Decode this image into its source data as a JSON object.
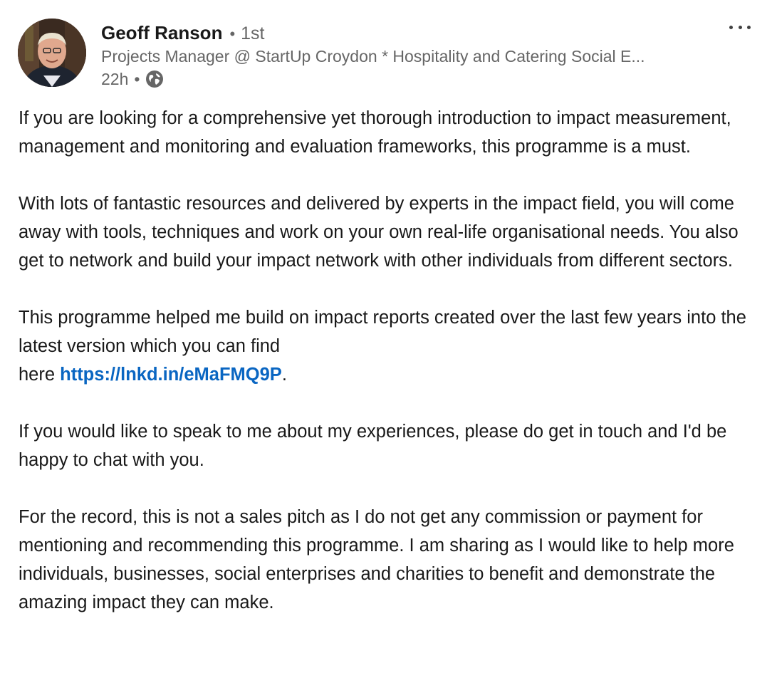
{
  "post": {
    "author": {
      "name": "Geoff Ranson",
      "separator": "•",
      "degree": "1st",
      "headline": "Projects Manager @ StartUp Croydon * Hospitality and Catering Social E...",
      "time": "22h",
      "time_separator": "•",
      "visibility_icon": "globe-icon"
    },
    "menu_icon": "more-options-icon",
    "body": {
      "p1": "If you are looking for a comprehensive yet thorough introduction to impact measurement, management and monitoring and evaluation frameworks, this programme is a must.",
      "p2": "With lots of fantastic resources and delivered by experts in the impact field, you will come away with tools, techniques and work on your own real-life organisational needs. You also get to network and build your impact network with other individuals from different sectors.",
      "p3_line1": "This programme helped me build on impact reports created over the last few years into the latest version which you can find",
      "p3_prefix": "here ",
      "p3_link": "https://lnkd.in/eMaFMQ9P",
      "p3_suffix": ".",
      "p4": "If you would like to speak to me about my experiences, please do get in touch and I'd be happy to chat with you.",
      "p5": "For the record, this is not a sales pitch as I do not get any commission or payment for mentioning and recommending this programme. I am sharing as I would like to help more individuals, businesses, social enterprises and charities to benefit and demonstrate the amazing impact they can make."
    },
    "colors": {
      "link": "#0a66c2",
      "text": "#191919",
      "secondary": "#666666"
    }
  }
}
